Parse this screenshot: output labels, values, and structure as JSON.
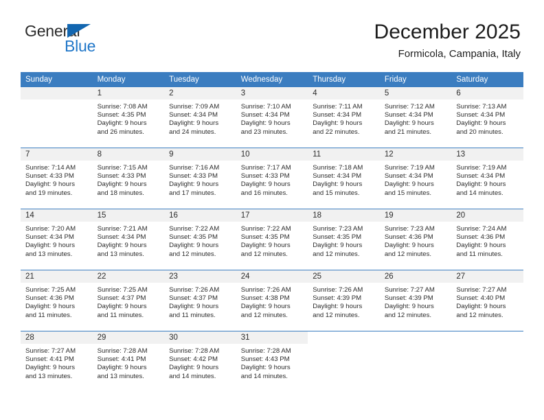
{
  "brand": {
    "name_top": "General",
    "name_bottom": "Blue",
    "color_top": "#2b2b2b",
    "color_bottom": "#1f76c8",
    "triangle_color": "#1266b0"
  },
  "header": {
    "title": "December 2025",
    "subtitle": "Formicola, Campania, Italy"
  },
  "theme": {
    "header_bg": "#3b7dc0",
    "header_text": "#ffffff",
    "daynum_band_bg": "#f1f1f1",
    "row_divider": "#3b7dc0",
    "body_text": "#2b2b2b"
  },
  "weekdays": [
    "Sunday",
    "Monday",
    "Tuesday",
    "Wednesday",
    "Thursday",
    "Friday",
    "Saturday"
  ],
  "weeks": [
    [
      {
        "day": "",
        "lines": []
      },
      {
        "day": "1",
        "lines": [
          "Sunrise: 7:08 AM",
          "Sunset: 4:35 PM",
          "Daylight: 9 hours",
          "and 26 minutes."
        ]
      },
      {
        "day": "2",
        "lines": [
          "Sunrise: 7:09 AM",
          "Sunset: 4:34 PM",
          "Daylight: 9 hours",
          "and 24 minutes."
        ]
      },
      {
        "day": "3",
        "lines": [
          "Sunrise: 7:10 AM",
          "Sunset: 4:34 PM",
          "Daylight: 9 hours",
          "and 23 minutes."
        ]
      },
      {
        "day": "4",
        "lines": [
          "Sunrise: 7:11 AM",
          "Sunset: 4:34 PM",
          "Daylight: 9 hours",
          "and 22 minutes."
        ]
      },
      {
        "day": "5",
        "lines": [
          "Sunrise: 7:12 AM",
          "Sunset: 4:34 PM",
          "Daylight: 9 hours",
          "and 21 minutes."
        ]
      },
      {
        "day": "6",
        "lines": [
          "Sunrise: 7:13 AM",
          "Sunset: 4:34 PM",
          "Daylight: 9 hours",
          "and 20 minutes."
        ]
      }
    ],
    [
      {
        "day": "7",
        "lines": [
          "Sunrise: 7:14 AM",
          "Sunset: 4:33 PM",
          "Daylight: 9 hours",
          "and 19 minutes."
        ]
      },
      {
        "day": "8",
        "lines": [
          "Sunrise: 7:15 AM",
          "Sunset: 4:33 PM",
          "Daylight: 9 hours",
          "and 18 minutes."
        ]
      },
      {
        "day": "9",
        "lines": [
          "Sunrise: 7:16 AM",
          "Sunset: 4:33 PM",
          "Daylight: 9 hours",
          "and 17 minutes."
        ]
      },
      {
        "day": "10",
        "lines": [
          "Sunrise: 7:17 AM",
          "Sunset: 4:33 PM",
          "Daylight: 9 hours",
          "and 16 minutes."
        ]
      },
      {
        "day": "11",
        "lines": [
          "Sunrise: 7:18 AM",
          "Sunset: 4:34 PM",
          "Daylight: 9 hours",
          "and 15 minutes."
        ]
      },
      {
        "day": "12",
        "lines": [
          "Sunrise: 7:19 AM",
          "Sunset: 4:34 PM",
          "Daylight: 9 hours",
          "and 15 minutes."
        ]
      },
      {
        "day": "13",
        "lines": [
          "Sunrise: 7:19 AM",
          "Sunset: 4:34 PM",
          "Daylight: 9 hours",
          "and 14 minutes."
        ]
      }
    ],
    [
      {
        "day": "14",
        "lines": [
          "Sunrise: 7:20 AM",
          "Sunset: 4:34 PM",
          "Daylight: 9 hours",
          "and 13 minutes."
        ]
      },
      {
        "day": "15",
        "lines": [
          "Sunrise: 7:21 AM",
          "Sunset: 4:34 PM",
          "Daylight: 9 hours",
          "and 13 minutes."
        ]
      },
      {
        "day": "16",
        "lines": [
          "Sunrise: 7:22 AM",
          "Sunset: 4:35 PM",
          "Daylight: 9 hours",
          "and 12 minutes."
        ]
      },
      {
        "day": "17",
        "lines": [
          "Sunrise: 7:22 AM",
          "Sunset: 4:35 PM",
          "Daylight: 9 hours",
          "and 12 minutes."
        ]
      },
      {
        "day": "18",
        "lines": [
          "Sunrise: 7:23 AM",
          "Sunset: 4:35 PM",
          "Daylight: 9 hours",
          "and 12 minutes."
        ]
      },
      {
        "day": "19",
        "lines": [
          "Sunrise: 7:23 AM",
          "Sunset: 4:36 PM",
          "Daylight: 9 hours",
          "and 12 minutes."
        ]
      },
      {
        "day": "20",
        "lines": [
          "Sunrise: 7:24 AM",
          "Sunset: 4:36 PM",
          "Daylight: 9 hours",
          "and 11 minutes."
        ]
      }
    ],
    [
      {
        "day": "21",
        "lines": [
          "Sunrise: 7:25 AM",
          "Sunset: 4:36 PM",
          "Daylight: 9 hours",
          "and 11 minutes."
        ]
      },
      {
        "day": "22",
        "lines": [
          "Sunrise: 7:25 AM",
          "Sunset: 4:37 PM",
          "Daylight: 9 hours",
          "and 11 minutes."
        ]
      },
      {
        "day": "23",
        "lines": [
          "Sunrise: 7:26 AM",
          "Sunset: 4:37 PM",
          "Daylight: 9 hours",
          "and 11 minutes."
        ]
      },
      {
        "day": "24",
        "lines": [
          "Sunrise: 7:26 AM",
          "Sunset: 4:38 PM",
          "Daylight: 9 hours",
          "and 12 minutes."
        ]
      },
      {
        "day": "25",
        "lines": [
          "Sunrise: 7:26 AM",
          "Sunset: 4:39 PM",
          "Daylight: 9 hours",
          "and 12 minutes."
        ]
      },
      {
        "day": "26",
        "lines": [
          "Sunrise: 7:27 AM",
          "Sunset: 4:39 PM",
          "Daylight: 9 hours",
          "and 12 minutes."
        ]
      },
      {
        "day": "27",
        "lines": [
          "Sunrise: 7:27 AM",
          "Sunset: 4:40 PM",
          "Daylight: 9 hours",
          "and 12 minutes."
        ]
      }
    ],
    [
      {
        "day": "28",
        "lines": [
          "Sunrise: 7:27 AM",
          "Sunset: 4:41 PM",
          "Daylight: 9 hours",
          "and 13 minutes."
        ]
      },
      {
        "day": "29",
        "lines": [
          "Sunrise: 7:28 AM",
          "Sunset: 4:41 PM",
          "Daylight: 9 hours",
          "and 13 minutes."
        ]
      },
      {
        "day": "30",
        "lines": [
          "Sunrise: 7:28 AM",
          "Sunset: 4:42 PM",
          "Daylight: 9 hours",
          "and 14 minutes."
        ]
      },
      {
        "day": "31",
        "lines": [
          "Sunrise: 7:28 AM",
          "Sunset: 4:43 PM",
          "Daylight: 9 hours",
          "and 14 minutes."
        ]
      },
      {
        "day": "",
        "lines": []
      },
      {
        "day": "",
        "lines": []
      },
      {
        "day": "",
        "lines": []
      }
    ]
  ]
}
